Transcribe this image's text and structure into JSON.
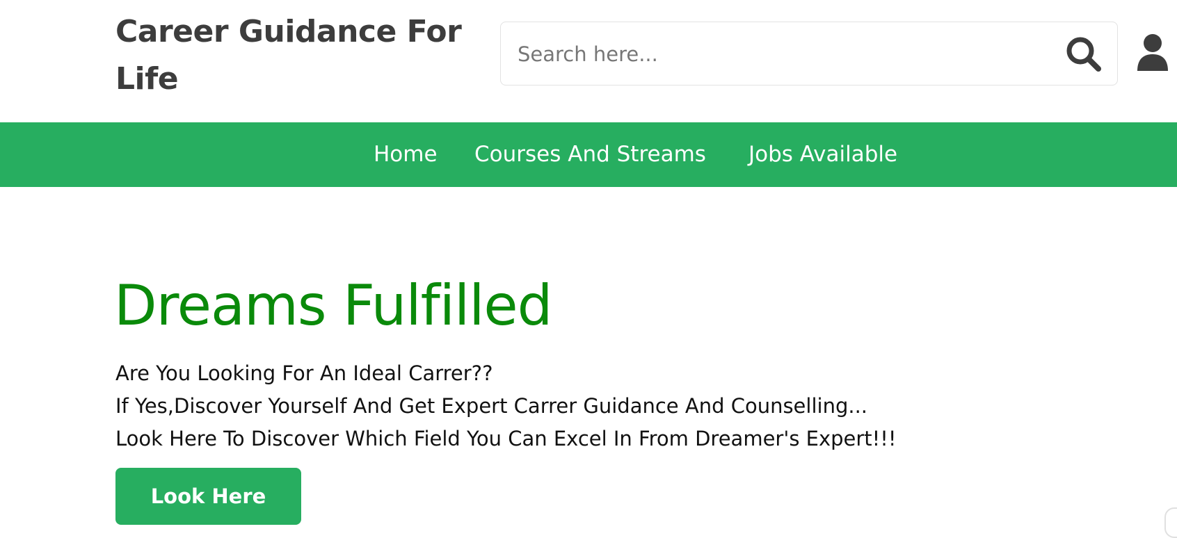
{
  "header": {
    "brand_line1": "Career Guidance For",
    "brand_line2": "Life",
    "search_placeholder": "Search here...",
    "search_icon": "search-icon",
    "user_icon": "user-icon",
    "text_color": "#3d3d3d"
  },
  "nav": {
    "background": "#27ae60",
    "items": [
      {
        "label": "Home"
      },
      {
        "label": "Courses And Streams"
      },
      {
        "label": "Jobs Available"
      }
    ]
  },
  "hero": {
    "title": "Dreams Fulfilled",
    "title_color": "#0a8a0a",
    "lines": [
      "Are You Looking For An Ideal Carrer??",
      "If Yes,Discover Yourself And Get Expert Carrer Guidance And Counselling...",
      "Look Here To Discover Which Field You Can Excel In From Dreamer's Expert!!!"
    ],
    "button_label": "Look Here",
    "button_color": "#27ae60"
  }
}
